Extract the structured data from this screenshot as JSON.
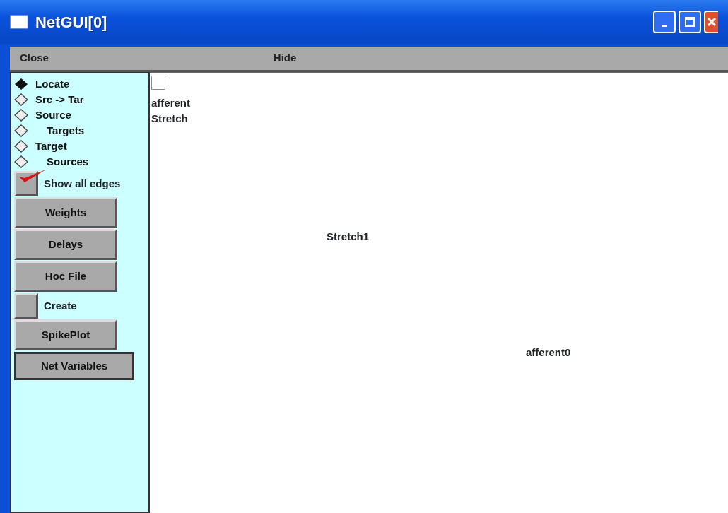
{
  "window": {
    "title": "NetGUI[0]"
  },
  "menu": [
    "Close",
    "Hide"
  ],
  "modes": [
    {
      "label": "Locate",
      "selected": true
    },
    {
      "label": "Src -> Tar",
      "selected": false
    },
    {
      "label": "Source",
      "selected": false,
      "children": [
        {
          "label": "Targets",
          "selected": false
        }
      ]
    },
    {
      "label": "Target",
      "selected": false,
      "children": [
        {
          "label": "Sources",
          "selected": false
        }
      ]
    }
  ],
  "controls": [
    {
      "kind": "checkbox",
      "label": "Show all edges",
      "checked": true
    },
    {
      "kind": "button",
      "label": "Weights"
    },
    {
      "kind": "button",
      "label": "Delays"
    },
    {
      "kind": "button",
      "label": "Hoc File"
    },
    {
      "kind": "checkbox",
      "label": "Create",
      "checked": false
    },
    {
      "kind": "button",
      "label": "SpikePlot"
    },
    {
      "kind": "button",
      "label": "Net Variables"
    }
  ],
  "canvas": {
    "checkbox": {
      "checked": false
    },
    "labels": [
      "afferent\nStretch",
      "Stretch1",
      "afferent0"
    ]
  }
}
